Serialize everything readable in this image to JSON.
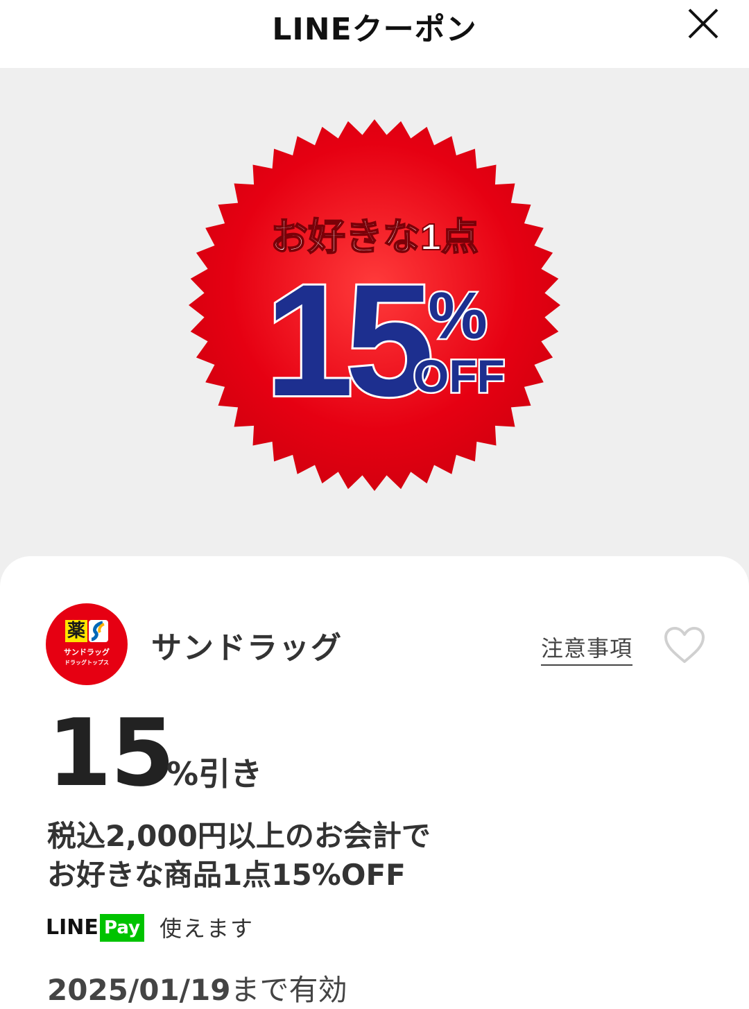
{
  "header": {
    "title": "LINEクーポン",
    "close_icon": "close-icon"
  },
  "hero": {
    "badge_top_text": "お好きな1点",
    "badge_number": "15",
    "badge_percent": "%",
    "badge_off": "OFF",
    "colors": {
      "badge_red": "#e60012",
      "badge_blue": "#1d2f8f",
      "background": "#efefef"
    }
  },
  "store": {
    "name": "サンドラッグ",
    "logo_kanji": "薬",
    "logo_line1": "サンドラッグ",
    "logo_line2": "ドラッグトップス",
    "logo_color": "#e60012"
  },
  "actions": {
    "notes_label": "注意事項",
    "favorite_icon": "heart-icon"
  },
  "discount": {
    "number": "15",
    "unit": "%引き"
  },
  "description": {
    "line1": "税込2,000円以上のお会計で",
    "line2": "お好きな商品1点15%OFF"
  },
  "payment": {
    "logo_line": "LINE",
    "logo_pay": "Pay",
    "label": "使えます",
    "pay_color": "#00c300"
  },
  "validity": {
    "date": "2025/01/19",
    "suffix": "まで有効"
  }
}
